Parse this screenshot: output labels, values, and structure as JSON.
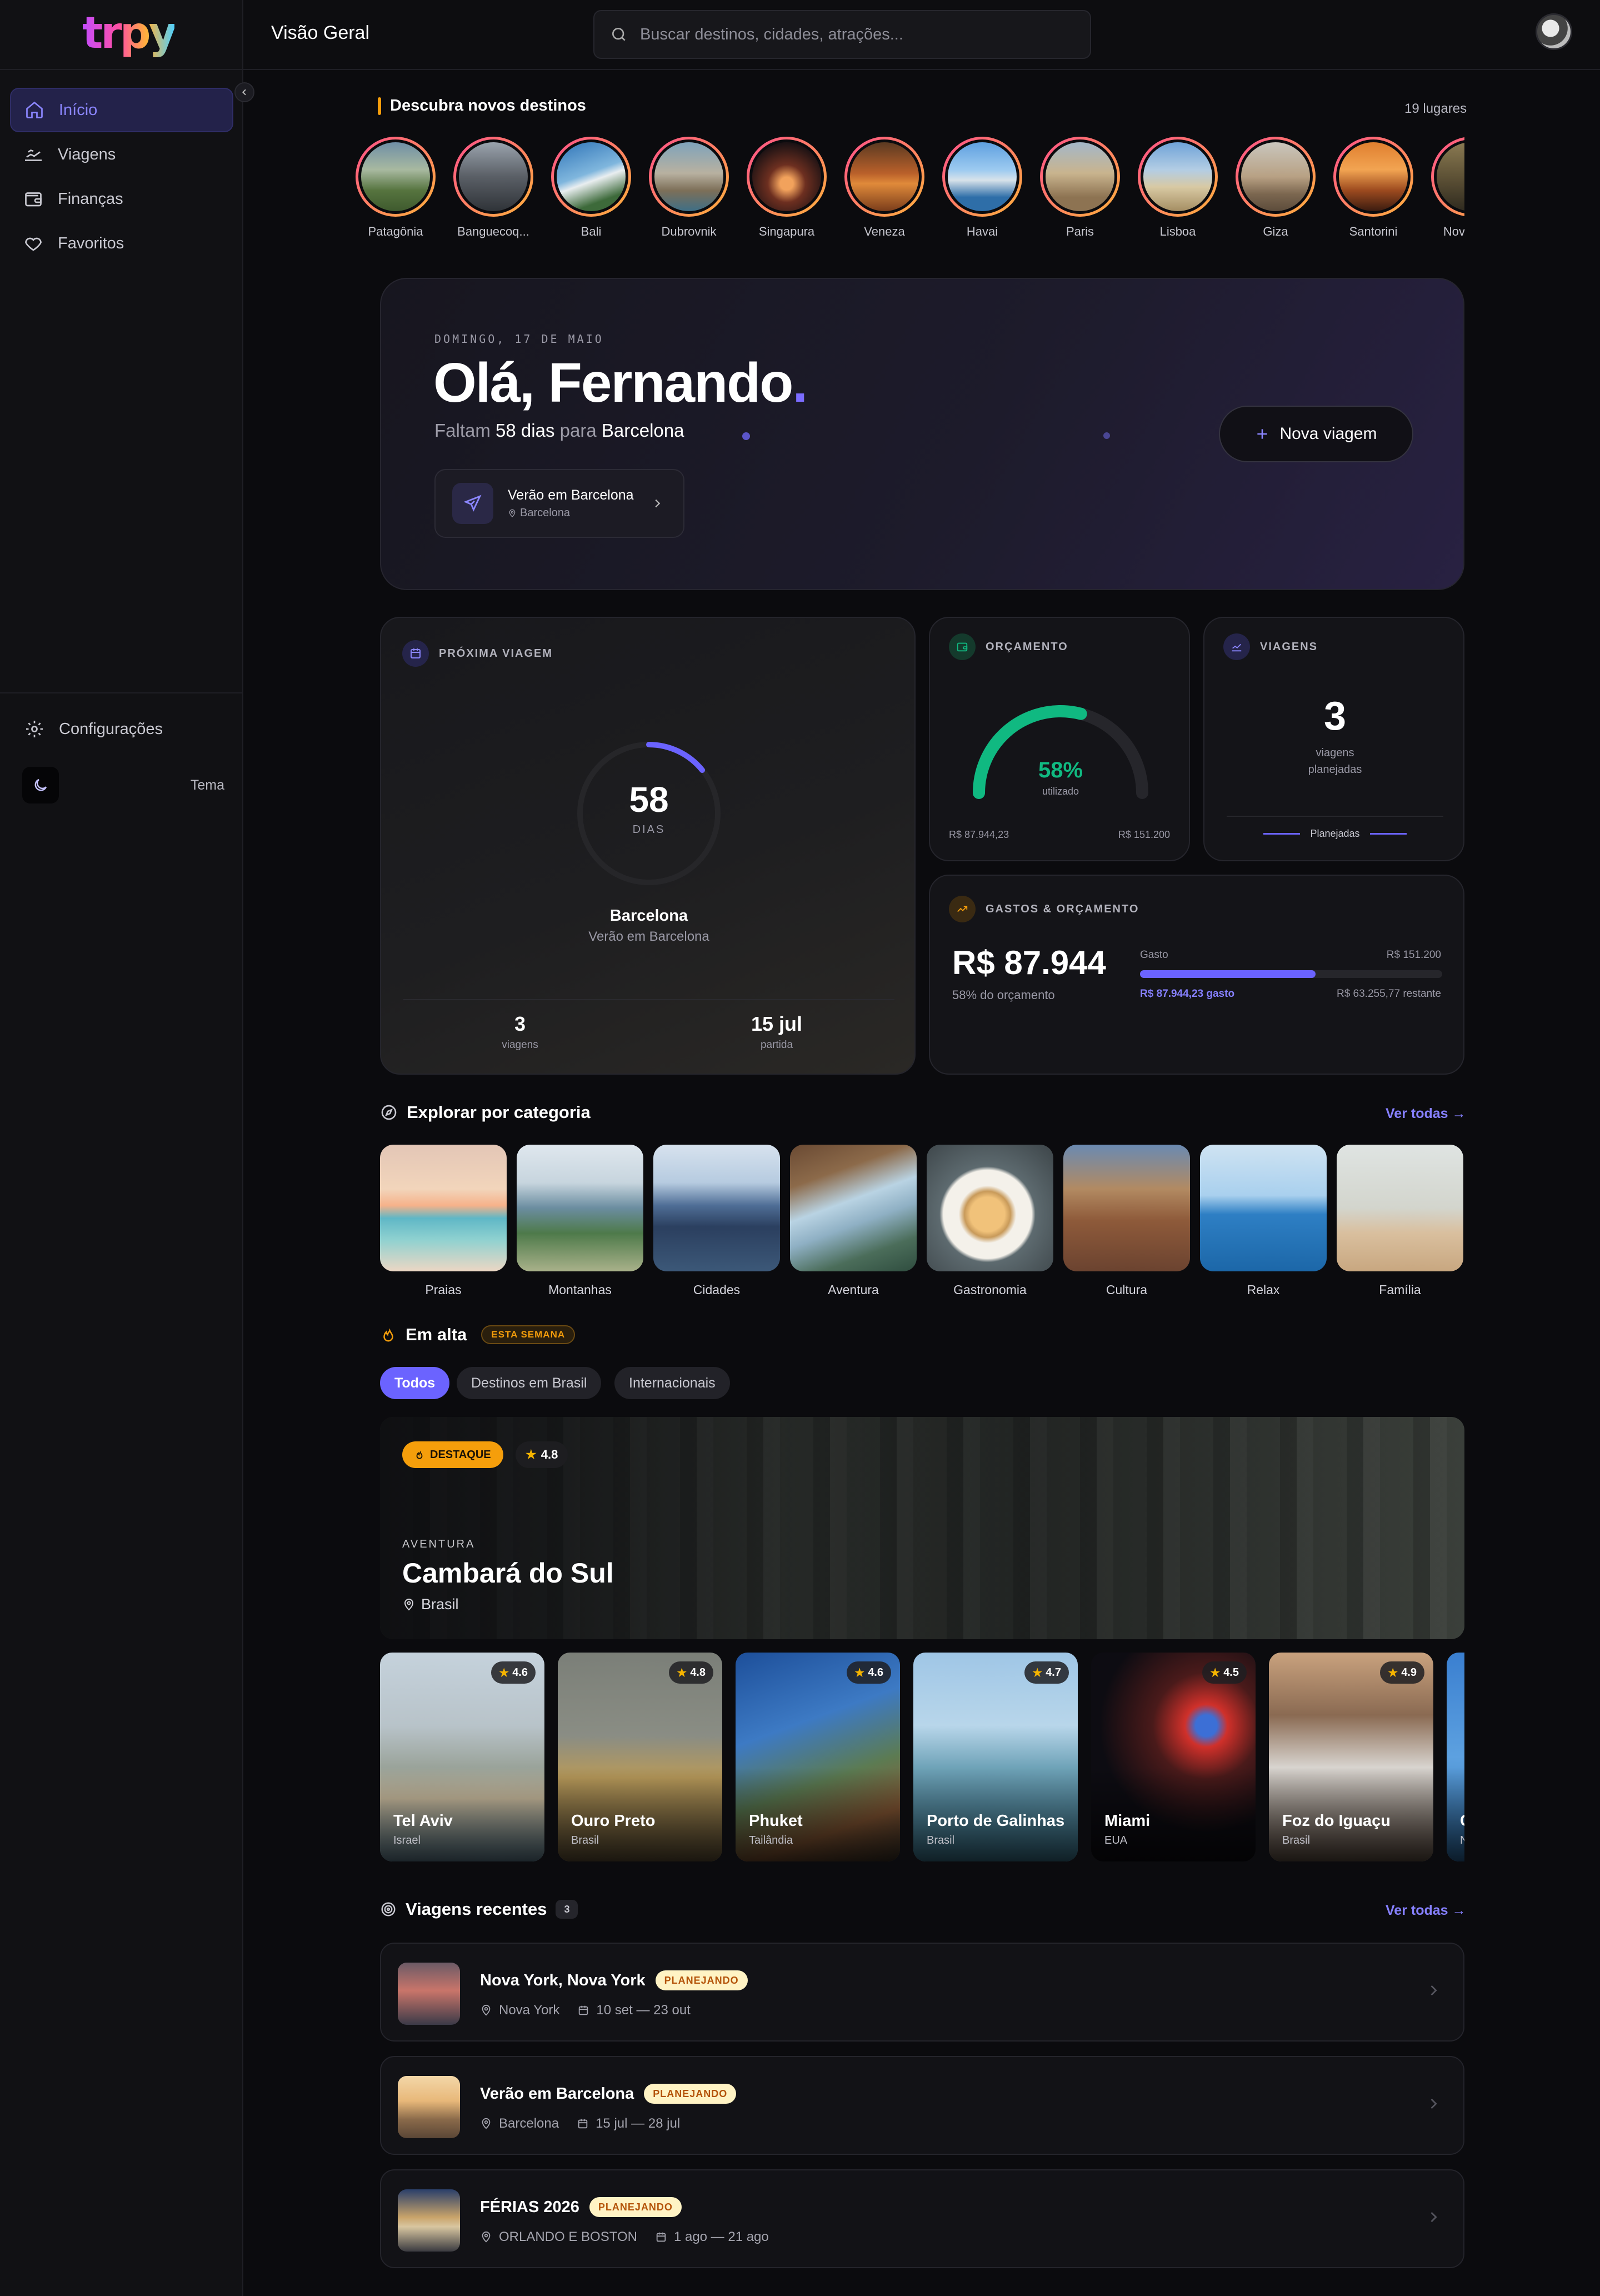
{
  "app": {
    "logo": "trpy",
    "page_title": "Visão Geral"
  },
  "search": {
    "placeholder": "Buscar destinos, cidades, atrações..."
  },
  "sidebar": {
    "items": [
      {
        "label": "Início",
        "icon": "home-icon",
        "active": true
      },
      {
        "label": "Viagens",
        "icon": "trip-icon",
        "active": false
      },
      {
        "label": "Finanças",
        "icon": "wallet-icon",
        "active": false
      },
      {
        "label": "Favoritos",
        "icon": "heart-icon",
        "active": false
      }
    ],
    "settings_label": "Configurações",
    "theme_label": "Tema"
  },
  "discover": {
    "title": "Descubra novos destinos",
    "count": "19 lugares",
    "places": [
      "Patagônia",
      "Banguecoq...",
      "Bali",
      "Dubrovnik",
      "Singapura",
      "Veneza",
      "Havai",
      "Paris",
      "Lisboa",
      "Giza",
      "Santorini",
      "Nova Yo..."
    ]
  },
  "hero": {
    "date": "DOMINGO, 17 DE MAIO",
    "greeting": "Olá, Fernando",
    "greeting_dot": ".",
    "sub_prefix": "Faltam",
    "days": "58 dias",
    "sub_mid": "para",
    "city": "Barcelona",
    "trip_title": "Verão em Barcelona",
    "trip_location": "Barcelona",
    "new_trip_label": "Nova viagem"
  },
  "next_trip": {
    "title": "PRÓXIMA VIAGEM",
    "days_value": "58",
    "days_label": "DIAS",
    "city": "Barcelona",
    "trip": "Verão em Barcelona",
    "trips_count": "3",
    "trips_label": "viagens",
    "departure": "15 jul",
    "departure_label": "partida"
  },
  "budget": {
    "title": "ORÇAMENTO",
    "percent": "58%",
    "percent_value": 0.58,
    "used_label": "utilizado",
    "spent": "R$ 87.944,23",
    "total": "R$ 151.200"
  },
  "trips": {
    "title": "VIAGENS",
    "count": "3",
    "label_line1": "viagens",
    "label_line2": "planejadas",
    "legend": "Planejadas"
  },
  "expenses": {
    "title": "GASTOS & ORÇAMENTO",
    "amount": "R$ 87.944",
    "percent_text": "58% do orçamento",
    "bar_label": "Gasto",
    "bar_total": "R$ 151.200",
    "bar_value": 0.58,
    "spent_text": "R$ 87.944,23 gasto",
    "remaining_text": "R$ 63.255,77 restante"
  },
  "categories": {
    "title": "Explorar por categoria",
    "see_all": "Ver todas →",
    "items": [
      "Praias",
      "Montanhas",
      "Cidades",
      "Aventura",
      "Gastronomia",
      "Cultura",
      "Relax",
      "Família"
    ]
  },
  "trending": {
    "title": "Em alta",
    "badge": "ESTA SEMANA",
    "filters": [
      "Todos",
      "Destinos em Brasil",
      "Internacionais"
    ],
    "feature": {
      "badge": "DESTAQUE",
      "rating": "4.8",
      "category": "AVENTURA",
      "name": "Cambará do Sul",
      "country": "Brasil"
    },
    "destinations": [
      {
        "name": "Tel Aviv",
        "country": "Israel",
        "rating": "4.6"
      },
      {
        "name": "Ouro Preto",
        "country": "Brasil",
        "rating": "4.8"
      },
      {
        "name": "Phuket",
        "country": "Tailândia",
        "rating": "4.6"
      },
      {
        "name": "Porto de Galinhas",
        "country": "Brasil",
        "rating": "4.7"
      },
      {
        "name": "Miami",
        "country": "EUA",
        "rating": "4.5"
      },
      {
        "name": "Foz do Iguaçu",
        "country": "Brasil",
        "rating": "4.9"
      },
      {
        "name": "C",
        "country": "N",
        "rating": ""
      }
    ]
  },
  "recent": {
    "title": "Viagens recentes",
    "count": "3",
    "see_all": "Ver todas →",
    "items": [
      {
        "title": "Nova York, Nova York",
        "status": "PLANEJANDO",
        "location": "Nova York",
        "dates": "10 set — 23 out"
      },
      {
        "title": "Verão em Barcelona",
        "status": "PLANEJANDO",
        "location": "Barcelona",
        "dates": "15 jul — 28 jul"
      },
      {
        "title": "FÉRIAS 2026",
        "status": "PLANEJANDO",
        "location": "ORLANDO E BOSTON",
        "dates": "1 ago — 21 ago"
      }
    ]
  },
  "colors": {
    "accent": "#6b63ff",
    "budget_green": "#10b981",
    "orange": "#f59e0b",
    "background": "#0b0b0e"
  }
}
